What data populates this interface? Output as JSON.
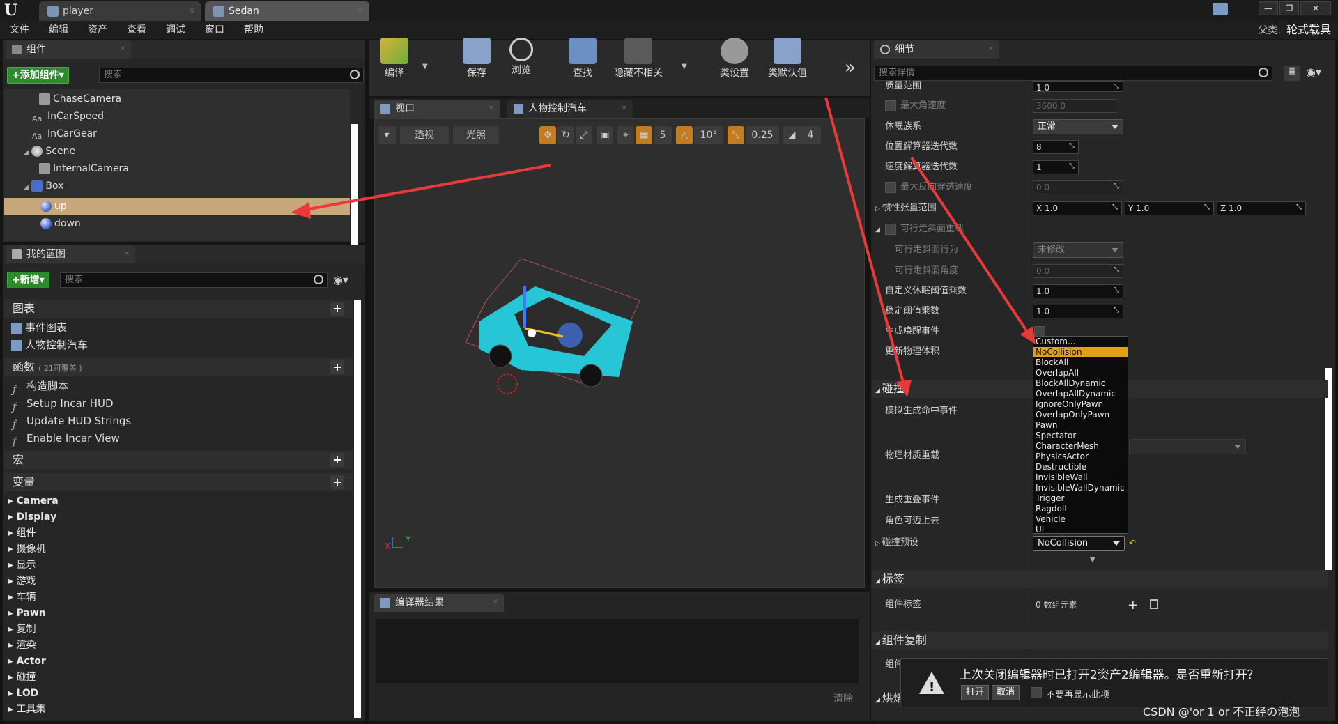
{
  "window": {
    "tabs": [
      "player",
      "Sedan"
    ],
    "parent_label": "父类:",
    "parent_value": "轮式载具",
    "controls": [
      "—",
      "❐",
      "✕"
    ]
  },
  "menu": [
    "文件",
    "编辑",
    "资产",
    "查看",
    "调试",
    "窗口",
    "帮助"
  ],
  "components": {
    "tab": "组件",
    "add_button": "+添加组件▾",
    "search_placeholder": "搜索",
    "items": [
      "ChaseCamera",
      "InCarSpeed",
      "InCarGear",
      "Scene",
      "InternalCamera",
      "Box",
      "up",
      "down"
    ]
  },
  "blueprint": {
    "tab": "我的蓝图",
    "new_button": "+新增▾",
    "search_placeholder": "搜索",
    "graphs_header": "图表",
    "graphs": [
      "事件图表",
      "人物控制汽车"
    ],
    "functions_header": "函数",
    "functions_note": "( 21可覆盖 )",
    "functions": [
      "构造脚本",
      "Setup Incar HUD",
      "Update HUD Strings",
      "Enable Incar View"
    ],
    "macros_header": "宏",
    "variables_header": "变量",
    "variables": [
      "Camera",
      "Display",
      "组件",
      "摄像机",
      "显示",
      "游戏",
      "车辆",
      "Pawn",
      "复制",
      "渲染",
      "Actor",
      "碰撞",
      "LOD",
      "工具集"
    ]
  },
  "toolbar": {
    "buttons": [
      "编译",
      "保存",
      "浏览",
      "查找",
      "隐藏不相关",
      "类设置",
      "类默认值"
    ],
    "more": "»"
  },
  "viewport": {
    "tabs": [
      "视口",
      "人物控制汽车"
    ],
    "perspective": "透视",
    "lighting": "光照",
    "grid_value": "5",
    "angle_value": "10°",
    "scale_value": "0.25",
    "camera_speed": "4",
    "axis_x": "X",
    "axis_y": "Y"
  },
  "compiler": {
    "tab": "编译器结果",
    "clear": "清除"
  },
  "details": {
    "tab": "细节",
    "search_placeholder": "搜索详情",
    "props": {
      "mass_range": "质量范围",
      "mass_range_val": "1.0",
      "max_angular": "最大角速度",
      "max_angular_val": "3600.0",
      "sleep_family": "休眠族系",
      "sleep_family_val": "正常",
      "pos_iter": "位置解算器迭代数",
      "pos_iter_val": "8",
      "vel_iter": "速度解算器迭代数",
      "vel_iter_val": "1",
      "max_depen": "最大反向穿透速度",
      "max_depen_val": "0.0",
      "inertia": "惯性张量范围",
      "inertia_x": "X  1.0",
      "inertia_y": "Y  1.0",
      "inertia_z": "Z  1.0",
      "walkable_override": "可行走斜面重载",
      "walkable_behavior": "可行走斜面行为",
      "walkable_behavior_val": "未修改",
      "walkable_angle": "可行走斜面角度",
      "walkable_angle_val": "0.0",
      "custom_sleep": "自定义休眠阈值乘数",
      "custom_sleep_val": "1.0",
      "stabilize": "稳定阈值乘数",
      "stabilize_val": "1.0",
      "wake_events": "生成唤醒事件",
      "update_mass": "更新物理体积",
      "collision_header": "碰撞",
      "sim_hit": "模拟生成命中事件",
      "phys_material": "物理材质重载",
      "overlap_events": "生成重叠事件",
      "step_up": "角色可迈上去",
      "preset": "碰撞预设",
      "preset_val": "NoCollision",
      "tags_header": "标签",
      "comp_tags": "组件标签",
      "comp_tags_val": "0 数组元素",
      "replication_header": "组件复制",
      "replication_item": "组件",
      "baking_header": "烘焙"
    },
    "dropdown": [
      "Custom...",
      "NoCollision",
      "BlockAll",
      "OverlapAll",
      "BlockAllDynamic",
      "OverlapAllDynamic",
      "IgnoreOnlyPawn",
      "OverlapOnlyPawn",
      "Pawn",
      "Spectator",
      "CharacterMesh",
      "PhysicsActor",
      "Destructible",
      "InvisibleWall",
      "InvisibleWallDynamic",
      "Trigger",
      "Ragdoll",
      "Vehicle",
      "UI"
    ]
  },
  "notice": {
    "message": "上次关闭编辑器时已打开2资产2编辑器。是否重新打开？",
    "open": "打开",
    "cancel": "取消",
    "dont_show": "不要再显示此项"
  },
  "watermark": "CSDN @'or 1 or 不正经の泡泡",
  "colors": {
    "accent_orange": "#e0a017",
    "selection_tan": "#c9a77a",
    "green_button": "#2f8a2f",
    "annotation_red": "#e83a3a"
  }
}
